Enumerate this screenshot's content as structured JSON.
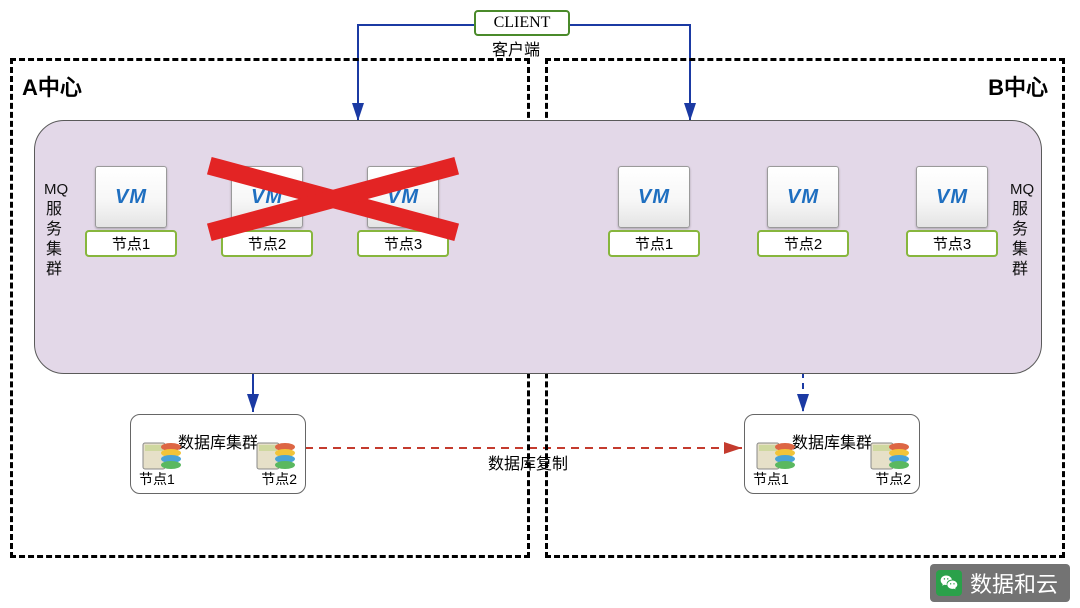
{
  "client": {
    "label": "CLIENT",
    "sub": "客户端"
  },
  "centers": {
    "a": {
      "title": "A中心",
      "mq_label_en": "MQ",
      "mq_label_cn": "服务集群"
    },
    "b": {
      "title": "B中心",
      "mq_label_en": "MQ",
      "mq_label_cn": "服务集群"
    }
  },
  "mq_nodes": {
    "a": [
      {
        "caption": "节点1",
        "vm": "VM"
      },
      {
        "caption": "节点2",
        "vm": "VM"
      },
      {
        "caption": "节点3",
        "vm": "VM"
      }
    ],
    "b": [
      {
        "caption": "节点1",
        "vm": "VM"
      },
      {
        "caption": "节点2",
        "vm": "VM"
      },
      {
        "caption": "节点3",
        "vm": "VM"
      }
    ]
  },
  "db": {
    "a": {
      "title": "数据库集群",
      "nodes": [
        "节点1",
        "节点2"
      ]
    },
    "b": {
      "title": "数据库集群",
      "nodes": [
        "节点1",
        "节点2"
      ]
    }
  },
  "replication_label": "数据库复制",
  "watermark": "数据和云",
  "failure": {
    "crossed_nodes": [
      "A.节点2",
      "A.节点3"
    ],
    "dashed_link": "B-mq-to-db"
  },
  "colors": {
    "arrow_blue": "#1b3aa3",
    "repl_red": "#c43b2e",
    "cross_red": "#e32424",
    "node_border": "#87b63d",
    "mq_fill": "#e3d8e8"
  }
}
